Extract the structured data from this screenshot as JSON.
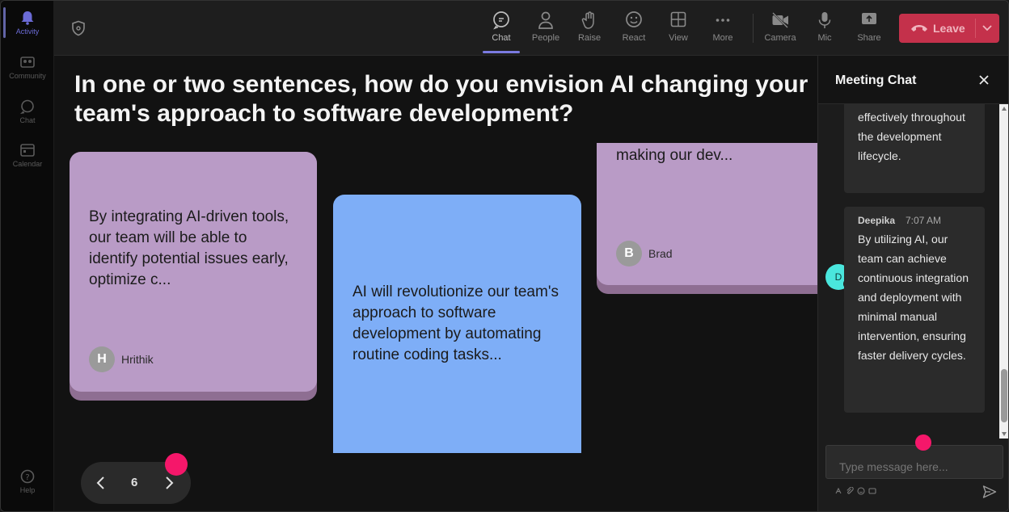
{
  "rail": {
    "items": [
      {
        "label": "Activity",
        "icon": "bell-icon",
        "active": true
      },
      {
        "label": "Community",
        "icon": "community-icon"
      },
      {
        "label": "Chat",
        "icon": "chat-icon"
      },
      {
        "label": "Calendar",
        "icon": "calendar-icon"
      },
      {
        "label": "Help",
        "icon": "help-icon"
      }
    ]
  },
  "toolbar": {
    "chat_label": "Chat",
    "people_label": "People",
    "raise_label": "Raise",
    "react_label": "React",
    "view_label": "View",
    "more_label": "More",
    "camera_label": "Camera",
    "mic_label": "Mic",
    "share_label": "Share",
    "leave_label": "Leave"
  },
  "stage": {
    "question": "In one or two sentences, how do you envision AI changing your team's approach to software development?",
    "question_line1": "In one or two sentences, how do you envision AI changing your",
    "question_line2": "team's approach to software development?",
    "notes": [
      {
        "text": "By integrating AI-driven tools, our team will be able to identify potential issues early, optimize c...",
        "author": "Hrithik",
        "initial": "H",
        "color": "#b99bc6"
      },
      {
        "text": "AI will revolutionize our team's approach to software development by automating routine coding tasks...",
        "author": "",
        "initial": "",
        "color": "#7eaef7"
      },
      {
        "text": "making our dev...",
        "author": "Brad",
        "initial": "B",
        "color": "#b99bc6"
      }
    ],
    "page_number": "6"
  },
  "chat": {
    "title": "Meeting Chat",
    "messages": [
      {
        "sender": "",
        "time": "",
        "text": "effectively throughout the development lifecycle."
      },
      {
        "sender": "Deepika",
        "initial": "D",
        "time": "7:07 AM",
        "text": "By utilizing AI, our team can achieve continuous integration and deployment with minimal manual intervention, ensuring faster delivery cycles."
      }
    ],
    "input_placeholder": "Type message here..."
  },
  "colors": {
    "accent": "#6264a7",
    "leave": "#c4314b",
    "highlight_dot": "#f5176a",
    "avatar_deepika": "#4ae6dd"
  }
}
